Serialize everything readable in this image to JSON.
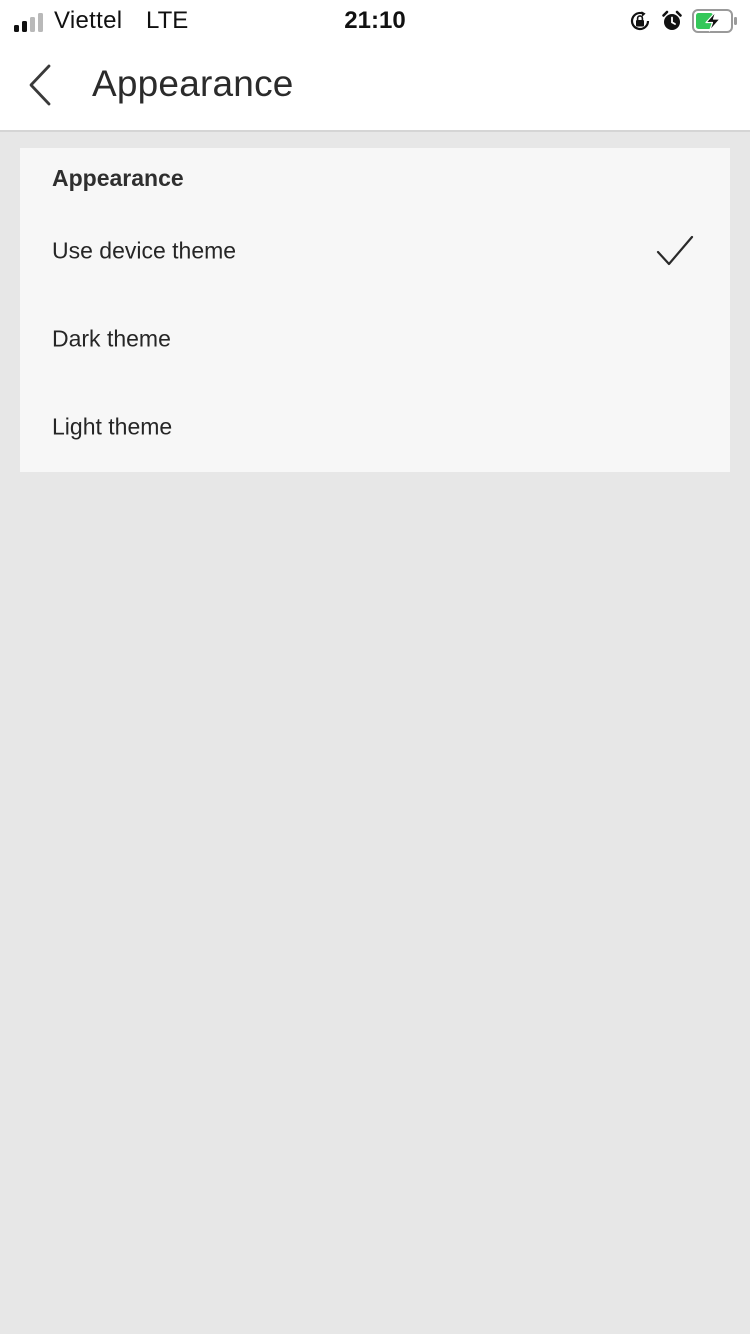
{
  "status_bar": {
    "carrier": "Viettel",
    "network": "LTE",
    "time": "21:10",
    "signal_bars_filled": 2,
    "signal_bars_total": 4,
    "battery_charging": true,
    "battery_color": "#34c759",
    "icons": [
      "orientation-lock-icon",
      "alarm-icon",
      "battery-charging-icon"
    ]
  },
  "header": {
    "back_icon": "chevron-left-icon",
    "title": "Appearance"
  },
  "settings": {
    "section_title": "Appearance",
    "options": [
      {
        "label": "Use device theme",
        "selected": true
      },
      {
        "label": "Dark theme",
        "selected": false
      },
      {
        "label": "Light theme",
        "selected": false
      }
    ],
    "check_icon": "checkmark-icon"
  },
  "colors": {
    "background": "#e7e7e7",
    "card": "#f7f7f7",
    "header": "#ffffff",
    "text": "#262626"
  }
}
